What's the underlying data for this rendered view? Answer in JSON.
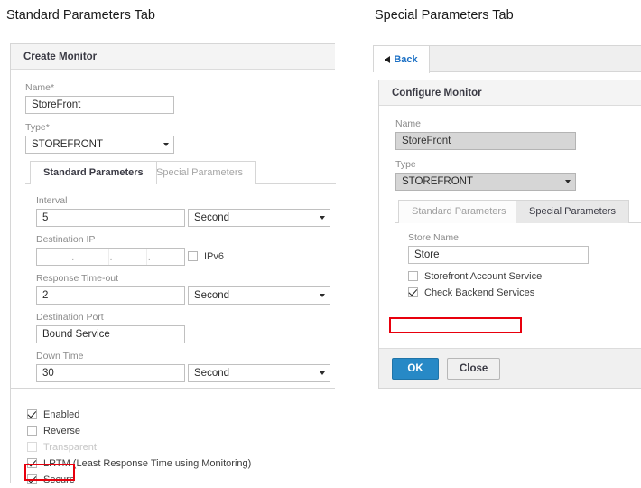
{
  "headings": {
    "left": "Standard Parameters Tab",
    "right": "Special Parameters Tab"
  },
  "left_panel": {
    "card_title": "Create Monitor",
    "fields": {
      "name_label": "Name*",
      "name_value": "StoreFront",
      "type_label": "Type*",
      "type_value": "STOREFRONT"
    },
    "tabs": [
      {
        "label": "Standard Parameters",
        "active": true
      },
      {
        "label": "Special Parameters",
        "active": false
      }
    ],
    "standard_parameters": {
      "interval_label": "Interval",
      "interval_value": "5",
      "interval_unit": "Second",
      "destination_ip_label": "Destination IP",
      "destination_ip_octets": [
        "",
        "",
        "",
        ""
      ],
      "ip_separator": ".",
      "ipv6_label": "IPv6",
      "ipv6_checked": false,
      "response_timeout_label": "Response Time-out",
      "response_timeout_value": "2",
      "response_timeout_unit": "Second",
      "destination_port_label": "Destination Port",
      "destination_port_value": "Bound Service",
      "down_time_label": "Down Time",
      "down_time_value": "30",
      "down_time_unit": "Second"
    },
    "options": [
      {
        "label": "Enabled",
        "checked": true,
        "disabled": false,
        "highlighted": false
      },
      {
        "label": "Reverse",
        "checked": false,
        "disabled": false,
        "highlighted": false
      },
      {
        "label": "Transparent",
        "checked": false,
        "disabled": true,
        "highlighted": false
      },
      {
        "label": "LRTM (Least Response Time using Monitoring)",
        "checked": true,
        "disabled": false,
        "highlighted": false
      },
      {
        "label": "Secure",
        "checked": true,
        "disabled": false,
        "highlighted": true
      }
    ]
  },
  "right_panel": {
    "back_label": "Back",
    "card_title": "Configure Monitor",
    "fields": {
      "name_label": "Name",
      "name_value": "StoreFront",
      "type_label": "Type",
      "type_value": "STOREFRONT"
    },
    "tabs": [
      {
        "label": "Standard Parameters",
        "active": false
      },
      {
        "label": "Special Parameters",
        "active": true
      }
    ],
    "special_parameters": {
      "store_name_label": "Store Name",
      "store_name_value": "Store",
      "options": [
        {
          "label": "Storefront Account Service",
          "checked": false,
          "highlighted": false
        },
        {
          "label": "Check Backend Services",
          "checked": true,
          "highlighted": true
        }
      ]
    },
    "buttons": {
      "ok": "OK",
      "close": "Close"
    }
  },
  "colors": {
    "primary_button": "#2789c6",
    "link": "#1a6fc4",
    "highlight": "#e8000d",
    "header_bg": "#f4f4f4",
    "disabled_bg": "#d6d6d6"
  }
}
